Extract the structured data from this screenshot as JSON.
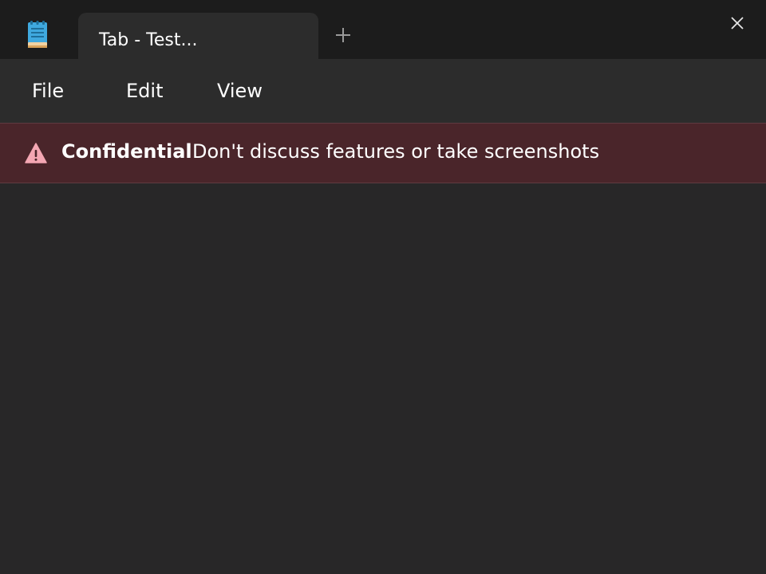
{
  "titlebar": {
    "app_icon": "notepad-icon",
    "tab": {
      "label": "Tab - Test..."
    },
    "new_tab_icon": "plus-icon",
    "close_icon": "close-icon"
  },
  "menu": {
    "items": [
      {
        "label": "File"
      },
      {
        "label": "Edit"
      },
      {
        "label": "View"
      }
    ]
  },
  "banner": {
    "icon": "warning-icon",
    "title": "Confidential",
    "message": "Don't discuss features or take screenshots",
    "background_color": "#4a252a",
    "icon_color": "#f4a7b3"
  },
  "editor": {
    "content": ""
  }
}
